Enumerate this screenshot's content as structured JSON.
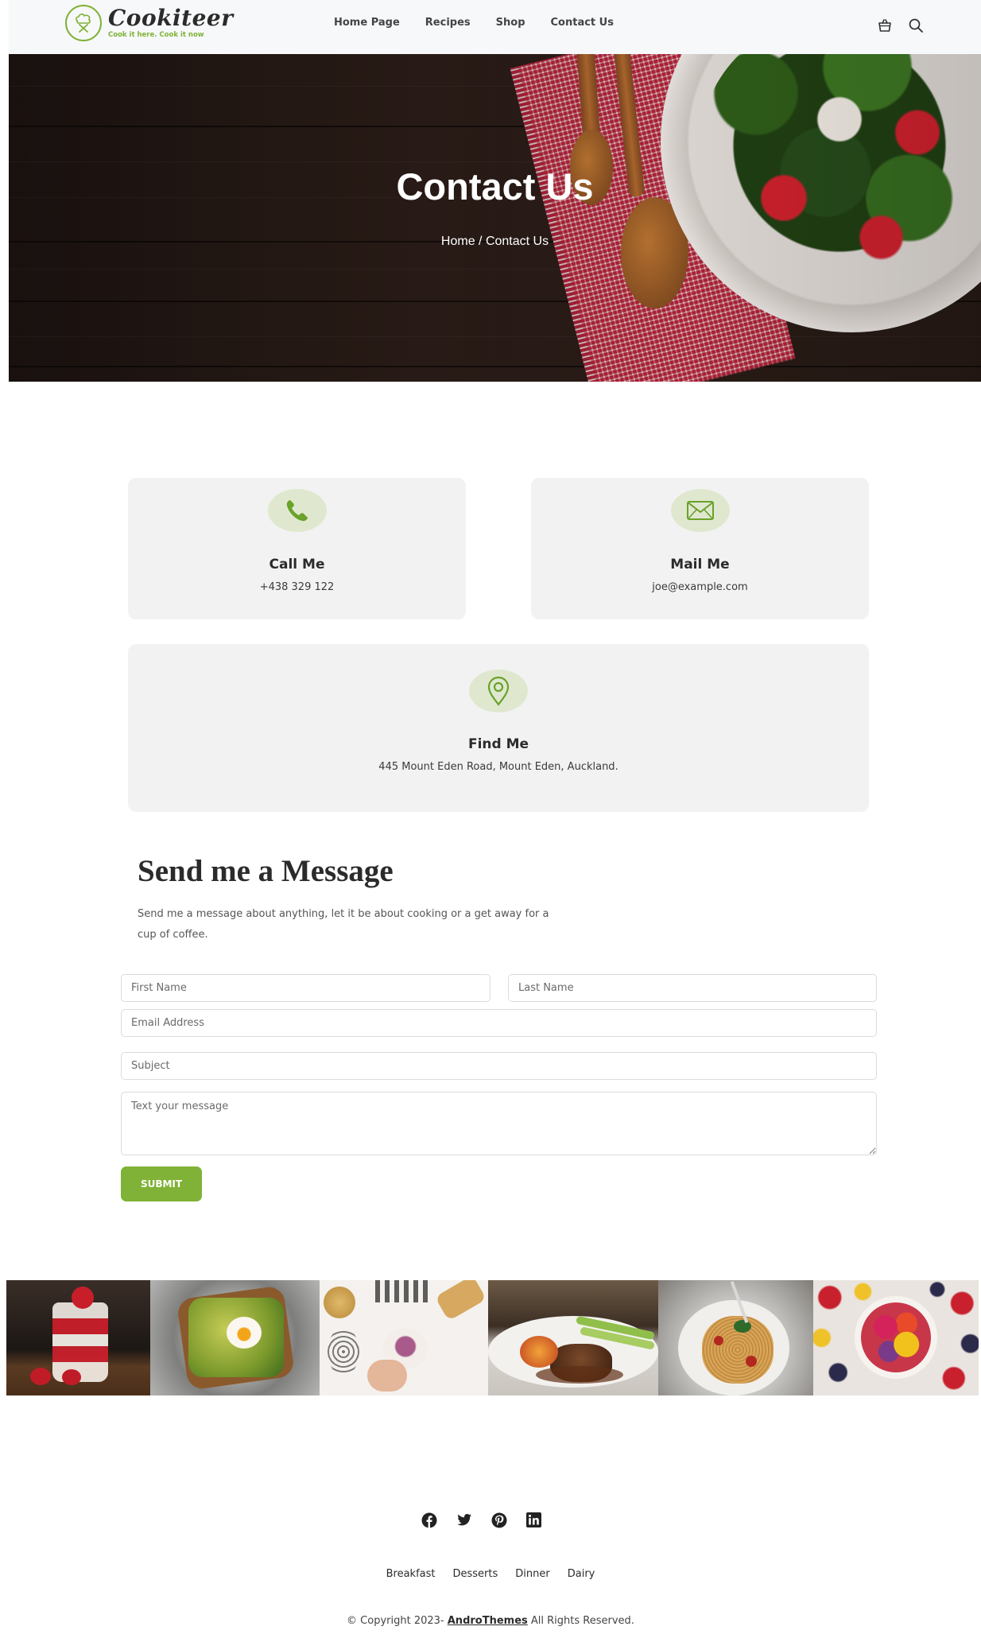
{
  "header": {
    "logo_name": "Cookiteer",
    "logo_tagline": "Cook it here. Cook it now",
    "nav": [
      "Home Page",
      "Recipes",
      "Shop",
      "Contact Us"
    ],
    "icons": [
      "cart-icon",
      "search-icon"
    ]
  },
  "hero": {
    "title": "Contact Us",
    "breadcrumb": "Home / Contact Us"
  },
  "contact_cards": {
    "call": {
      "title": "Call Me",
      "text": "+438 329 122",
      "icon": "phone-icon"
    },
    "mail": {
      "title": "Mail Me",
      "text": "joe@example.com",
      "icon": "envelope-icon"
    },
    "find": {
      "title": "Find Me",
      "text": "445 Mount Eden Road, Mount Eden, Auckland.",
      "icon": "location-pin-icon"
    }
  },
  "message": {
    "title": "Send me a Message",
    "description": "Send me a message about anything, let it be about cooking or a get away for a cup of coffee.",
    "first_name_placeholder": "First Name",
    "last_name_placeholder": "Last Name",
    "email_placeholder": "Email Address",
    "subject_placeholder": "Subject",
    "message_placeholder": "Text your message",
    "submit_label": "SUBMIT"
  },
  "gallery": [
    "strawberry-parfait-photo",
    "avocado-toast-egg-photo",
    "yogurt-granola-bowl-photo",
    "steak-asparagus-photo",
    "spaghetti-tomato-photo",
    "fruit-berry-bowl-photo"
  ],
  "footer": {
    "socials": [
      "facebook-icon",
      "twitter-icon",
      "pinterest-icon",
      "linkedin-icon"
    ],
    "links": [
      "Breakfast",
      "Desserts",
      "Dinner",
      "Dairy"
    ],
    "copyright_prefix": "© Copyright 2023- ",
    "copyright_brand": "AndroThemes",
    "copyright_suffix": " All Rights Reserved."
  },
  "colors": {
    "accent": "#7fb236",
    "icon_bubble": "#dfe8cf",
    "card_bg": "#f2f2f2",
    "header_bg": "#f7f8fa"
  }
}
